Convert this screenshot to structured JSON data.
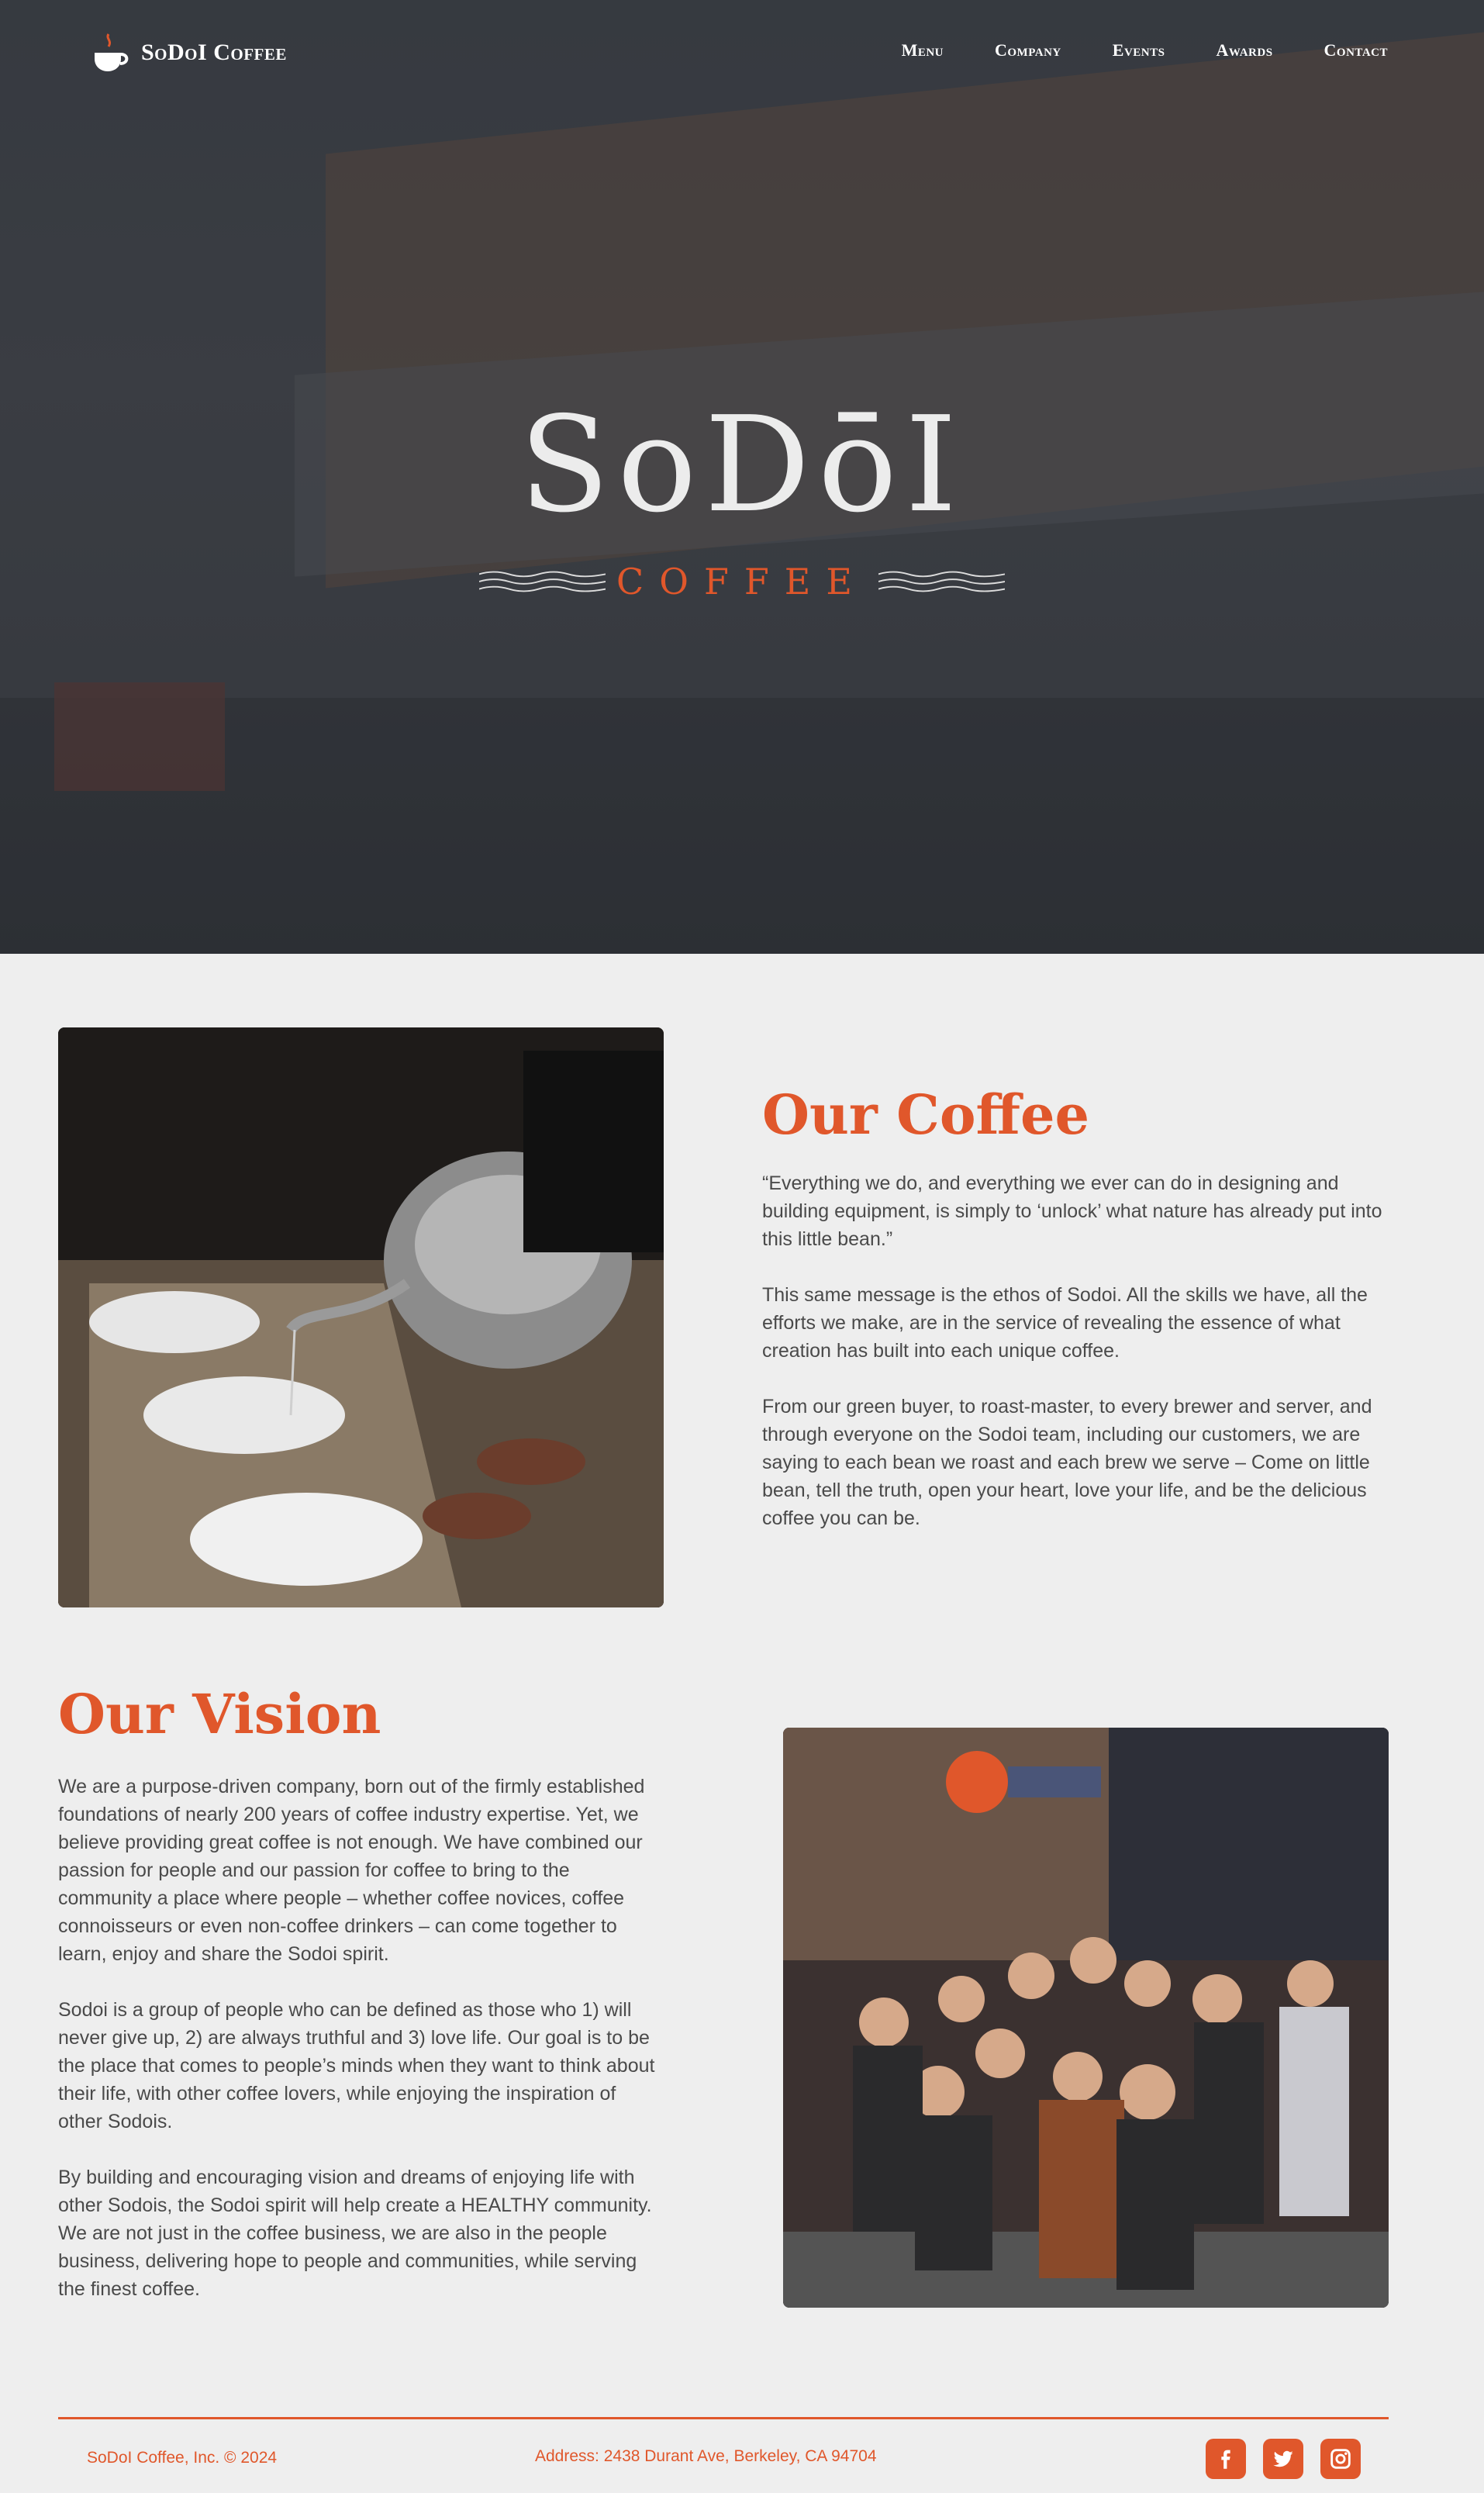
{
  "brand": {
    "name": "SoDoI Coffee"
  },
  "nav": {
    "items": [
      {
        "label": "Menu"
      },
      {
        "label": "Company"
      },
      {
        "label": "Events"
      },
      {
        "label": "Awards"
      },
      {
        "label": "Contact"
      }
    ]
  },
  "hero": {
    "wordmark": "SoDōI",
    "subtitle": "COFFEE"
  },
  "coffee": {
    "title": "Our Coffee",
    "paragraphs": [
      " “Everything we do, and everything we ever can do in designing and building equipment, is simply to ‘unlock’ what nature has already put into this little bean.”",
      "This same message is the ethos of Sodoi. All the skills we have, all the efforts we make, are in the service of revealing the essence of what creation has built into each unique coffee.",
      "From our green buyer, to roast-master, to every brewer and server, and through everyone on the Sodoi team, including our customers, we are saying to each bean we roast and each brew we serve – Come on little bean, tell the truth, open your heart, love your life, and be the delicious coffee you can be."
    ]
  },
  "vision": {
    "title": "Our Vision",
    "paragraphs": [
      "We are a purpose-driven company, born out of the firmly established foundations of nearly 200 years of coffee industry expertise. Yet, we believe providing great coffee is not enough. We have combined our passion for people and our passion for coffee to bring to the community a place where people – whether coffee novices, coffee connoisseurs or even non-coffee drinkers – can come together to learn, enjoy and share the Sodoi spirit.",
      "Sodoi is a group of people who can be defined as those who 1) will never give up, 2) are always truthful and 3) love life. Our goal is to be the place that comes to people’s minds when they want to think about their life, with other coffee lovers, while enjoying the inspiration of other Sodois.",
      "By building and encouraging vision and dreams of enjoying life with other Sodois, the Sodoi spirit will help create a HEALTHY community. We are not just in the coffee business, we are also in the people business, delivering hope to people and communities, while serving the finest coffee."
    ]
  },
  "footer": {
    "copyright": "SoDoI Coffee, Inc. © 2024",
    "address": "Address:  2438 Durant Ave, Berkeley, CA 94704",
    "social": [
      "facebook-icon",
      "twitter-icon",
      "instagram-icon"
    ]
  },
  "colors": {
    "accent": "#e0572b",
    "background": "#eeeeee",
    "text": "#4a4a4a"
  }
}
